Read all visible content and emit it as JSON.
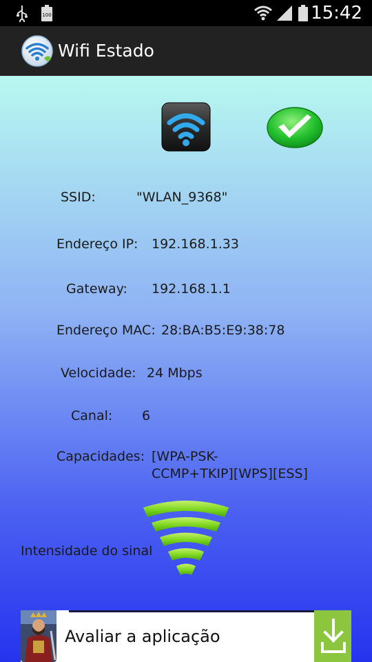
{
  "status_bar": {
    "time": "15:42",
    "battery_small_label": "100",
    "icons": [
      "usb-icon",
      "battery-full-icon",
      "wifi-icon",
      "signal-icon",
      "battery-icon"
    ]
  },
  "action_bar": {
    "title": "Wifi Estado",
    "logo_icon": "wifi-logo-icon"
  },
  "status": {
    "wifi_icon": "wifi-tile-icon",
    "connection_state_icon": "green-check-icon"
  },
  "info": {
    "ssid": {
      "label": "SSID:",
      "value": "\"WLAN_9368\""
    },
    "ip": {
      "label": "Endereço IP:",
      "value": "192.168.1.33"
    },
    "gateway": {
      "label": "Gateway:",
      "value": "192.168.1.1"
    },
    "mac": {
      "label": "Endereço MAC:",
      "value": "28:BA:B5:E9:38:78"
    },
    "speed": {
      "label": "Velocidade:",
      "value": "24 Mbps"
    },
    "channel": {
      "label": "Canal:",
      "value": "6"
    },
    "capabilities": {
      "label": "Capacidades:",
      "value_line1": "[WPA-PSK-",
      "value_line2": "CCMP+TKIP][WPS][ESS]"
    }
  },
  "signal": {
    "label": "Intensidade do sinal",
    "icon": "signal-strength-icon",
    "bars_lit": 5,
    "bars_total": 5
  },
  "ad": {
    "text": "Avaliar a aplicação",
    "image_icon": "game-character-icon",
    "action_icon": "download-icon"
  },
  "colors": {
    "background_top": "#b8f8f0",
    "background_bottom": "#2633ee",
    "signal_green": "#7dd61e",
    "check_green": "#22c02e",
    "ad_green": "#8cc63f"
  }
}
